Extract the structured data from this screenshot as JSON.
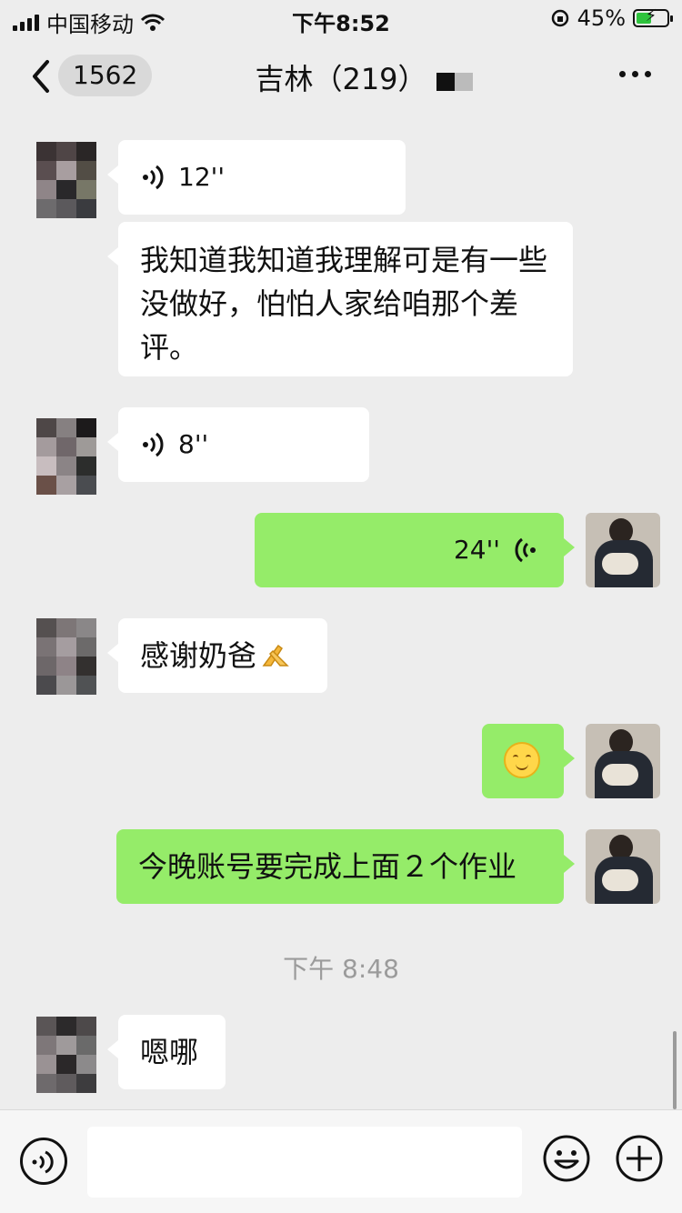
{
  "status_bar": {
    "carrier": "中国移动",
    "time": "下午8:52",
    "battery": "45%"
  },
  "nav": {
    "unread_count": "1562",
    "title": "吉林（219）"
  },
  "messages": [
    {
      "side": "left",
      "type": "voice",
      "duration": "12''"
    },
    {
      "side": "left",
      "type": "text",
      "text": "我知道我知道我理解可是有一些没做好，怕怕人家给咱那个差评。"
    },
    {
      "side": "left",
      "type": "voice",
      "duration": "8''"
    },
    {
      "side": "right",
      "type": "voice",
      "duration": "24''"
    },
    {
      "side": "left",
      "type": "text",
      "text": "感谢奶爸"
    },
    {
      "side": "right",
      "type": "emoji",
      "emoji": "smiling-face"
    },
    {
      "side": "right",
      "type": "text",
      "text": "今晚账号要完成上面２个作业"
    },
    {
      "side": "left",
      "type": "text",
      "text": "嗯哪"
    }
  ],
  "timestamp": "下午 8:48",
  "colors": {
    "background": "#ededed",
    "sent_bubble": "#95ec69",
    "received_bubble": "#ffffff"
  },
  "icons": [
    "back-icon",
    "more-icon",
    "voice-icon",
    "voice-toggle-icon",
    "emoji-icon",
    "plus-icon"
  ]
}
